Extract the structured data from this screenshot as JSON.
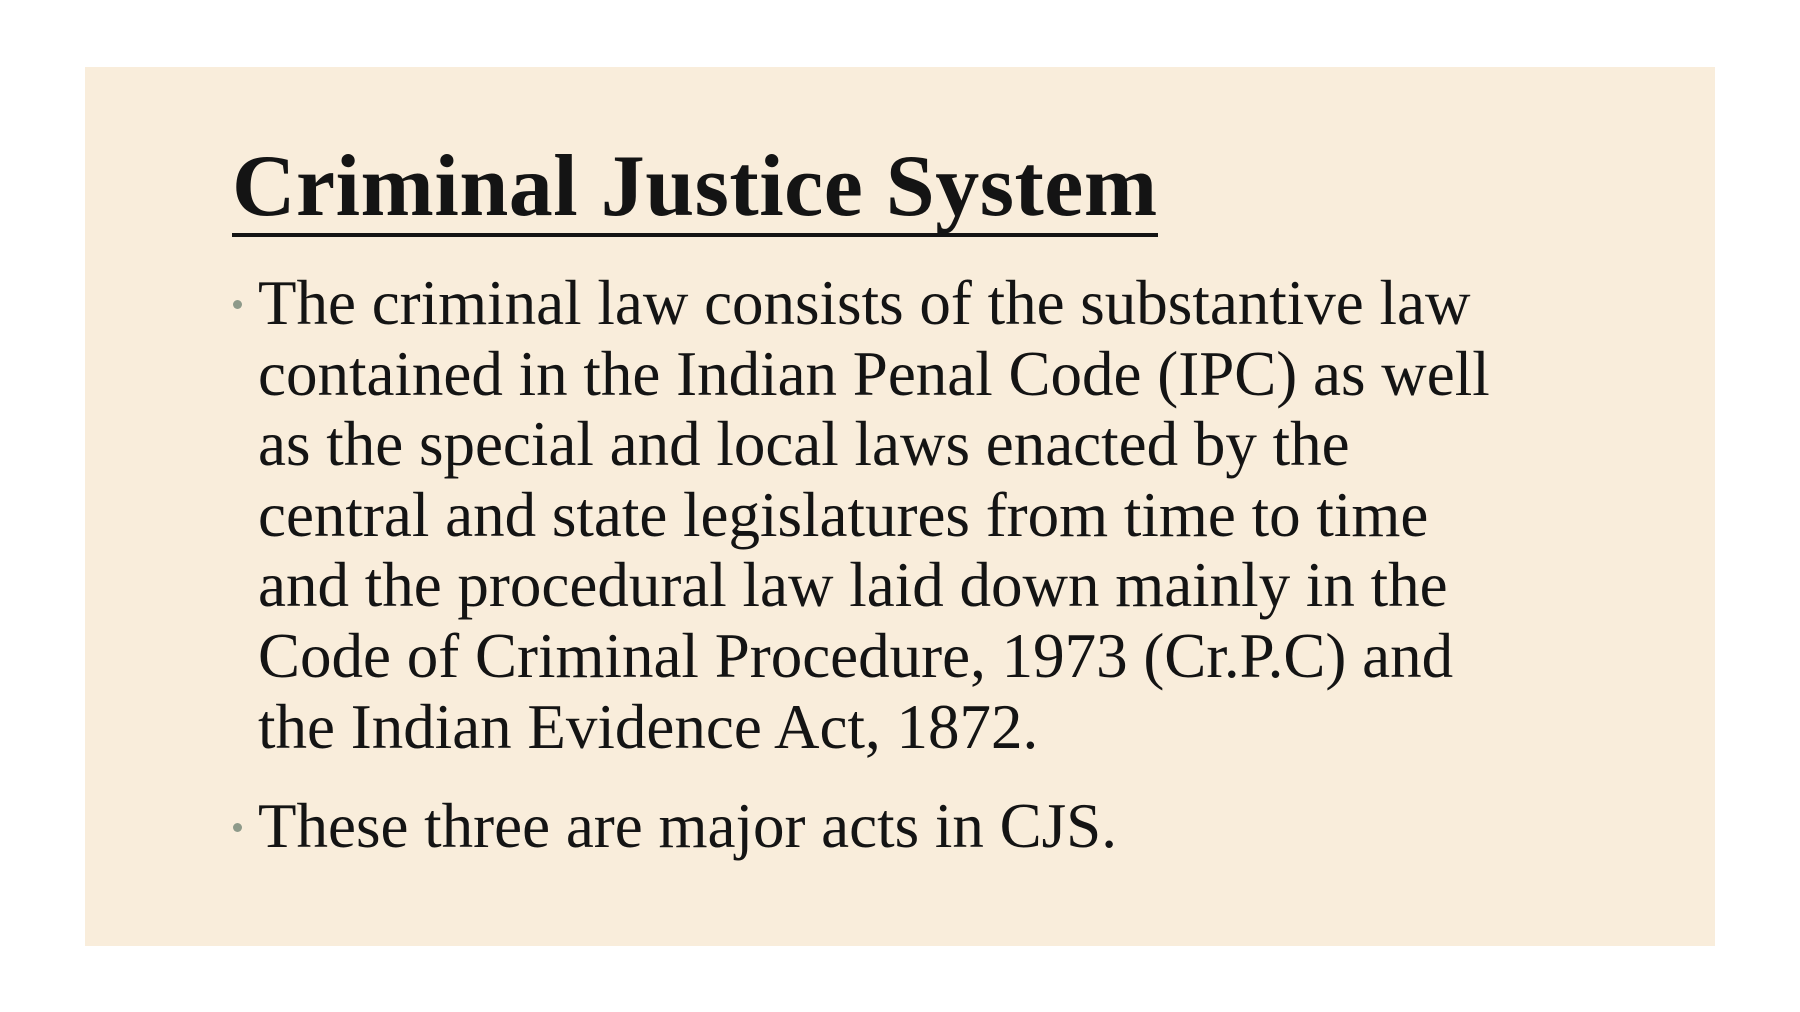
{
  "slide": {
    "title": "Criminal Justice System",
    "bullets": [
      {
        "lines": [
          "The criminal law consists of the substantive law",
          "contained in the Indian Penal Code (IPC) as well",
          "as the special and local laws enacted by the",
          "central and state legislatures from time to time",
          "and the procedural law laid down mainly in the",
          "Code of Criminal Procedure, 1973 (Cr.P.C) and",
          "the Indian Evidence Act, 1872."
        ]
      },
      {
        "lines": [
          "These three are major acts in CJS."
        ]
      }
    ],
    "colors": {
      "background": "#f9eddb",
      "text": "#141414",
      "bullet": "#8e9a8a"
    }
  }
}
